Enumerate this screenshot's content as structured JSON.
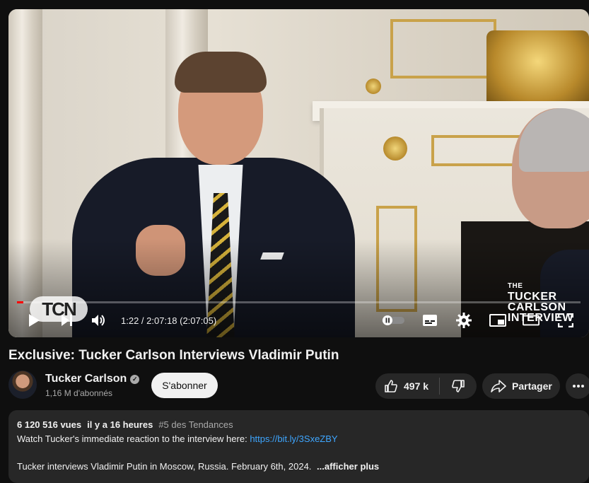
{
  "player": {
    "brand_watermark": {
      "line1": "THE",
      "line2": "TUCKER",
      "line3": "CARLSON",
      "line4": "INTERVIEW"
    },
    "overlay_logo": "TCN",
    "time_display": "1:22 / 2:07:18 (2:07:05)",
    "progress_fraction": 0.011,
    "accent_color": "#ff0000",
    "icons": {
      "play": "play-icon",
      "next": "next-icon",
      "volume": "volume-icon",
      "autoplay": "autoplay-toggle-icon",
      "subtitles": "subtitles-icon",
      "settings": "gear-icon",
      "miniplayer": "miniplayer-icon",
      "theater": "theater-mode-icon",
      "fullscreen": "fullscreen-icon"
    }
  },
  "video": {
    "title": "Exclusive: Tucker Carlson Interviews Vladimir Putin"
  },
  "channel": {
    "name": "Tucker Carlson",
    "subscribers": "1,16 M d'abonnés",
    "subscribe_label": "S'abonner"
  },
  "actions": {
    "likes": "497 k",
    "share_label": "Partager"
  },
  "description": {
    "views": "6 120 516 vues",
    "posted": "il y a 16 heures",
    "trending": "#5 des Tendances",
    "line1_text": "Watch Tucker's immediate reaction to the interview here: ",
    "line1_link": "https://bit.ly/3SxeZBY",
    "line2_text": "Tucker interviews Vladimir Putin in Moscow, Russia. February 6th, 2024.",
    "show_more": "...afficher plus"
  }
}
